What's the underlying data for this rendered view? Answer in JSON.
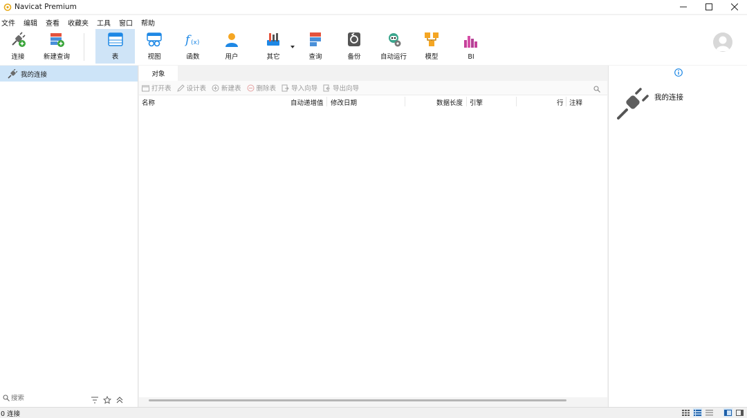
{
  "window": {
    "title": "Navicat Premium"
  },
  "menu": [
    "文件",
    "编辑",
    "查看",
    "收藏夹",
    "工具",
    "窗口",
    "帮助"
  ],
  "toolbar": {
    "items": [
      {
        "label": "连接",
        "icon": "connection-plug-icon"
      },
      {
        "label": "新建查询",
        "icon": "new-query-icon"
      },
      {
        "label": "表",
        "icon": "table-icon",
        "active": true
      },
      {
        "label": "视图",
        "icon": "view-icon"
      },
      {
        "label": "函数",
        "icon": "function-icon"
      },
      {
        "label": "用户",
        "icon": "user-icon"
      },
      {
        "label": "其它",
        "icon": "other-tools-icon"
      },
      {
        "label": "查询",
        "icon": "query-icon"
      },
      {
        "label": "备份",
        "icon": "backup-icon"
      },
      {
        "label": "自动运行",
        "icon": "automation-robot-icon"
      },
      {
        "label": "模型",
        "icon": "model-icon"
      },
      {
        "label": "BI",
        "icon": "bi-chart-icon"
      }
    ]
  },
  "sidebar": {
    "connection_label": "我的连接",
    "search_placeholder": "搜索"
  },
  "main": {
    "tab": "对象",
    "actions": [
      "打开表",
      "设计表",
      "新建表",
      "删除表",
      "导入向导",
      "导出向导"
    ],
    "columns": [
      "名称",
      "自动递增值",
      "修改日期",
      "数据长度",
      "引擎",
      "行",
      "注释"
    ]
  },
  "info_panel": {
    "title": "我的连接"
  },
  "status": {
    "text": "0 连接"
  },
  "colors": {
    "accent": "#cfe4f7",
    "selection": "#cde4f8",
    "brand_blue": "#1e88e5"
  }
}
